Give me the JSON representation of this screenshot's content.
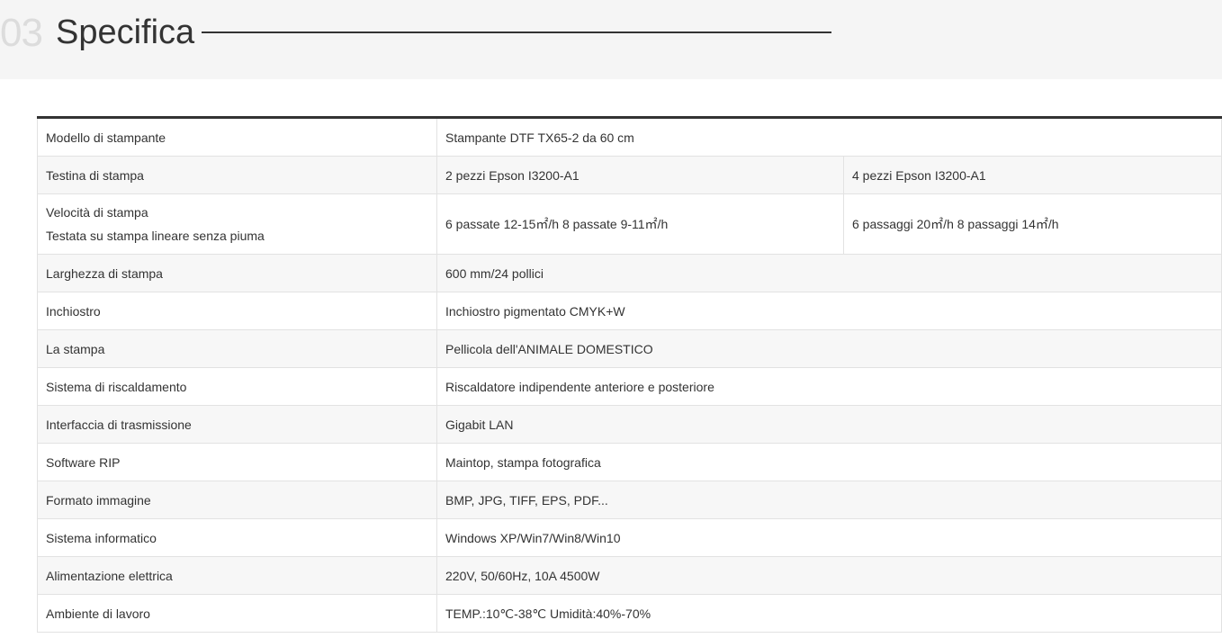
{
  "section": {
    "number": "03",
    "title": "Specifica"
  },
  "specs": {
    "rows": [
      {
        "label": "Modello di stampante",
        "value": "Stampante DTF TX65-2 da 60 cm"
      },
      {
        "label": "Testina di stampa",
        "value": "2 pezzi Epson I3200-A1",
        "value2": "4 pezzi Epson I3200-A1"
      },
      {
        "label": "Velocità di stampa",
        "label2": "Testata su stampa lineare senza piuma",
        "value": "6 passate 12-15㎡/h 8 passate 9-11㎡/h",
        "value2": "6 passaggi 20㎡/h 8 passaggi 14㎡/h"
      },
      {
        "label": "Larghezza di stampa",
        "value": "600 mm/24 pollici"
      },
      {
        "label": "Inchiostro",
        "value": "Inchiostro pigmentato CMYK+W"
      },
      {
        "label": "La stampa",
        "value": "Pellicola dell'ANIMALE DOMESTICO"
      },
      {
        "label": "Sistema di riscaldamento",
        "value": "Riscaldatore indipendente anteriore e posteriore"
      },
      {
        "label": "Interfaccia di trasmissione",
        "value": "Gigabit LAN"
      },
      {
        "label": "Software RIP",
        "value": "Maintop, stampa fotografica"
      },
      {
        "label": "Formato immagine",
        "value": "BMP, JPG, TIFF, EPS, PDF..."
      },
      {
        "label": "Sistema informatico",
        "value": "Windows XP/Win7/Win8/Win10"
      },
      {
        "label": "Alimentazione elettrica",
        "value": "220V, 50/60Hz, 10A 4500W"
      },
      {
        "label": "Ambiente di lavoro",
        "value": "TEMP.:10℃-38℃ Umidità:40%-70%"
      }
    ]
  }
}
